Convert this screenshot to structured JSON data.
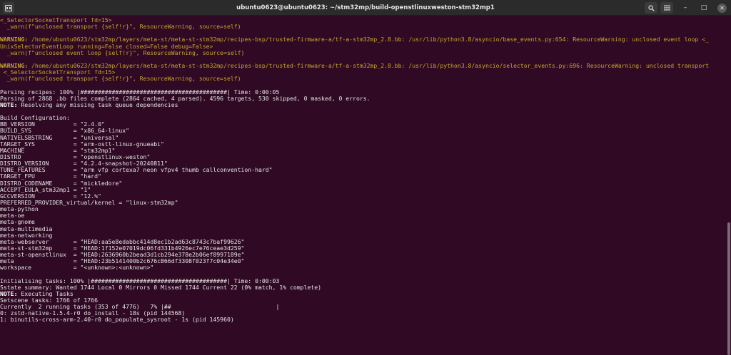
{
  "window": {
    "title": "ubuntu0623@ubuntu0623: ~/stm32mp/build-openstlinuxweston-stm32mp1"
  },
  "titlebar": {
    "new_tab_icon": "terminal-tab-icon",
    "search_icon": "search-icon",
    "menu_icon": "hamburger-menu-icon",
    "minimize_label": "–",
    "maximize_label": "□",
    "close_label": "✕"
  },
  "colors": {
    "background": "#300a24",
    "text": "#e4e4e4",
    "warning": "#c8a62a",
    "titlebar": "#2b2b2b"
  },
  "terminal": {
    "lines": [
      {
        "type": "warn",
        "text": "<_SelectorSocketTransport fd=15>"
      },
      {
        "type": "warn",
        "text": "  _warn(f\"unclosed transport {self!r}\", ResourceWarning, source=self)"
      },
      {
        "type": "blank",
        "text": ""
      },
      {
        "type": "warning",
        "label": "WARNING:",
        "text": " /home/ubuntu0623/stm32mp/layers/meta-st/meta-st-stm32mp/recipes-bsp/trusted-firmware-a/tf-a-stm32mp_2.8.bb: /usr/lib/python3.8/asyncio/base_events.py:654: ResourceWarning: unclosed event loop <_"
      },
      {
        "type": "warn",
        "text": "UnixSelectorEventLoop running=False closed=False debug=False>"
      },
      {
        "type": "warn",
        "text": "  _warn(f\"unclosed event loop {self!r}\", ResourceWarning, source=self)"
      },
      {
        "type": "blank",
        "text": ""
      },
      {
        "type": "warning",
        "label": "WARNING:",
        "text": " /home/ubuntu0623/stm32mp/layers/meta-st/meta-st-stm32mp/recipes-bsp/trusted-firmware-a/tf-a-stm32mp_2.8.bb: /usr/lib/python3.8/asyncio/selector_events.py:696: ResourceWarning: unclosed transport"
      },
      {
        "type": "warn",
        "text": " <_SelectorSocketTransport fd=15>"
      },
      {
        "type": "warn",
        "text": "  _warn(f\"unclosed transport {self!r}\", ResourceWarning, source=self)"
      },
      {
        "type": "blank",
        "text": ""
      },
      {
        "type": "normal",
        "text": "Parsing recipes: 100% |##########################################| Time: 0:00:05"
      },
      {
        "type": "normal",
        "text": "Parsing of 2868 .bb files complete (2864 cached, 4 parsed). 4596 targets, 530 skipped, 0 masked, 0 errors."
      },
      {
        "type": "note",
        "label": "NOTE:",
        "text": " Resolving any missing task queue dependencies"
      },
      {
        "type": "blank",
        "text": ""
      },
      {
        "type": "normal",
        "text": "Build Configuration:"
      },
      {
        "type": "normal",
        "text": "BB_VERSION           = \"2.4.0\""
      },
      {
        "type": "normal",
        "text": "BUILD_SYS            = \"x86_64-linux\""
      },
      {
        "type": "normal",
        "text": "NATIVELSBSTRING      = \"universal\""
      },
      {
        "type": "normal",
        "text": "TARGET_SYS           = \"arm-ostl-linux-gnueabi\""
      },
      {
        "type": "normal",
        "text": "MACHINE              = \"stm32mp1\""
      },
      {
        "type": "normal",
        "text": "DISTRO               = \"openstlinux-weston\""
      },
      {
        "type": "normal",
        "text": "DISTRO_VERSION       = \"4.2.4-snapshot-20240811\""
      },
      {
        "type": "normal",
        "text": "TUNE_FEATURES        = \"arm vfp cortexa7 neon vfpv4 thumb callconvention-hard\""
      },
      {
        "type": "normal",
        "text": "TARGET_FPU           = \"hard\""
      },
      {
        "type": "normal",
        "text": "DISTRO_CODENAME      = \"mickledore\""
      },
      {
        "type": "normal",
        "text": "ACCEPT_EULA_stm32mp1 = \"1\""
      },
      {
        "type": "normal",
        "text": "GCCVERSION           = \"12.%\""
      },
      {
        "type": "normal",
        "text": "PREFERRED_PROVIDER_virtual/kernel = \"linux-stm32mp\""
      },
      {
        "type": "normal",
        "text": "meta-python"
      },
      {
        "type": "normal",
        "text": "meta-oe"
      },
      {
        "type": "normal",
        "text": "meta-gnome"
      },
      {
        "type": "normal",
        "text": "meta-multimedia"
      },
      {
        "type": "normal",
        "text": "meta-networking"
      },
      {
        "type": "normal",
        "text": "meta-webserver       = \"HEAD:aa5e8edabbc414d8ec1b2ad63c8743c7baf99626\""
      },
      {
        "type": "normal",
        "text": "meta-st-stm32mp      = \"HEAD:1f152e07019dc06fd331b4926ec7e76ceae3d259\""
      },
      {
        "type": "normal",
        "text": "meta-st-openstlinux  = \"HEAD:2636960b2bead3d1cb294e378e2b06ef8997189e\""
      },
      {
        "type": "normal",
        "text": "meta                 = \"HEAD:23b5141400b2c676c866df3308f023f7c04e34e0\""
      },
      {
        "type": "normal",
        "text": "workspace            = \"<unknown>:<unknown>\""
      },
      {
        "type": "blank",
        "text": ""
      },
      {
        "type": "normal",
        "text": "Initialising tasks: 100% |#######################################| Time: 0:00:03"
      },
      {
        "type": "normal",
        "text": "Sstate summary: Wanted 1744 Local 0 Mirrors 0 Missed 1744 Current 22 (0% match, 1% complete)"
      },
      {
        "type": "note",
        "label": "NOTE:",
        "text": " Executing Tasks"
      },
      {
        "type": "normal",
        "text": "Setscene tasks: 1766 of 1766"
      },
      {
        "type": "normal",
        "text": "Currently  2 running tasks (353 of 4776)   7% |##                              |"
      },
      {
        "type": "normal",
        "text": "0: zstd-native-1.5.4-r0 do_install - 18s (pid 144568)"
      },
      {
        "type": "normal",
        "text": "1: binutils-cross-arm-2.40-r0 do_populate_sysroot - 1s (pid 145960)"
      }
    ]
  }
}
